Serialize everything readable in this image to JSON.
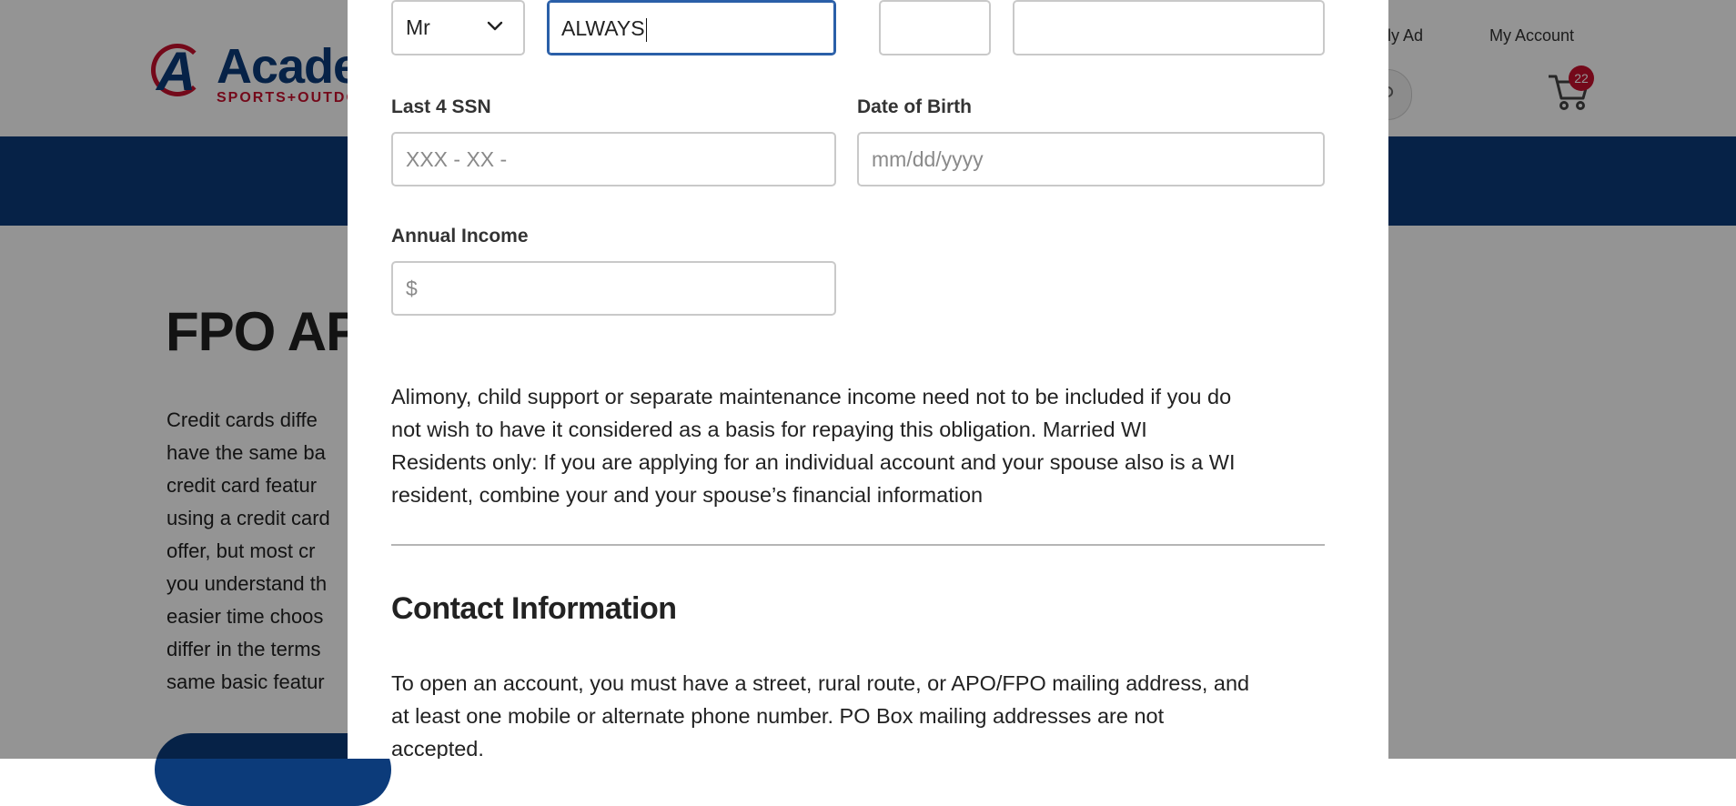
{
  "background_page": {
    "logo": {
      "mark": "A",
      "brand": "Acade",
      "tagline": "SPORTS+OUTDO"
    },
    "header_links": {
      "weekly_ad": "kly Ad",
      "my_account": "My Account"
    },
    "cart": {
      "count": "22"
    },
    "hero": {
      "title": "FPO APR",
      "body_lines": [
        "Credit cards diffe",
        "have the same ba",
        "credit card featur",
        "using a credit card",
        "offer, but most cr",
        "you understand th",
        "easier time choos",
        "differ in the terms",
        "same basic featur"
      ]
    },
    "colors": {
      "brand_blue": "#0c3b7a",
      "brand_red": "#c8102e"
    }
  },
  "form": {
    "title_select": {
      "value": "Mr"
    },
    "first_name": {
      "value": "ALWAYS"
    },
    "middle_initial": {
      "value": ""
    },
    "last_name": {
      "value": ""
    },
    "ssn": {
      "label": "Last 4 SSN",
      "placeholder": "XXX - XX -"
    },
    "dob": {
      "label": "Date of Birth",
      "placeholder": "mm/dd/yyyy"
    },
    "income": {
      "label": "Annual Income",
      "placeholder": "$"
    },
    "notice_lines": [
      "Alimony, child support or separate maintenance income need not to be included if you do",
      "not wish to have it  considered as a basis for repaying this obligation. Married WI",
      "Residents only: If you are applying for an individual account and your spouse also is a WI",
      "resident,  combine your and your spouse’s financial information"
    ],
    "contact": {
      "title": "Contact Information",
      "lines": [
        "To open an account, you must have a street, rural route, or APO/FPO mailing address, and",
        "at least one mobile or alternate phone number. PO Box mailing addresses are not",
        "accepted."
      ]
    }
  },
  "icons": {
    "select_chevron": "chevron-down-icon",
    "cart": "cart-icon",
    "search": "search-icon",
    "scroll_up": "arrow-up-icon",
    "scroll_down": "arrow-down-icon"
  }
}
